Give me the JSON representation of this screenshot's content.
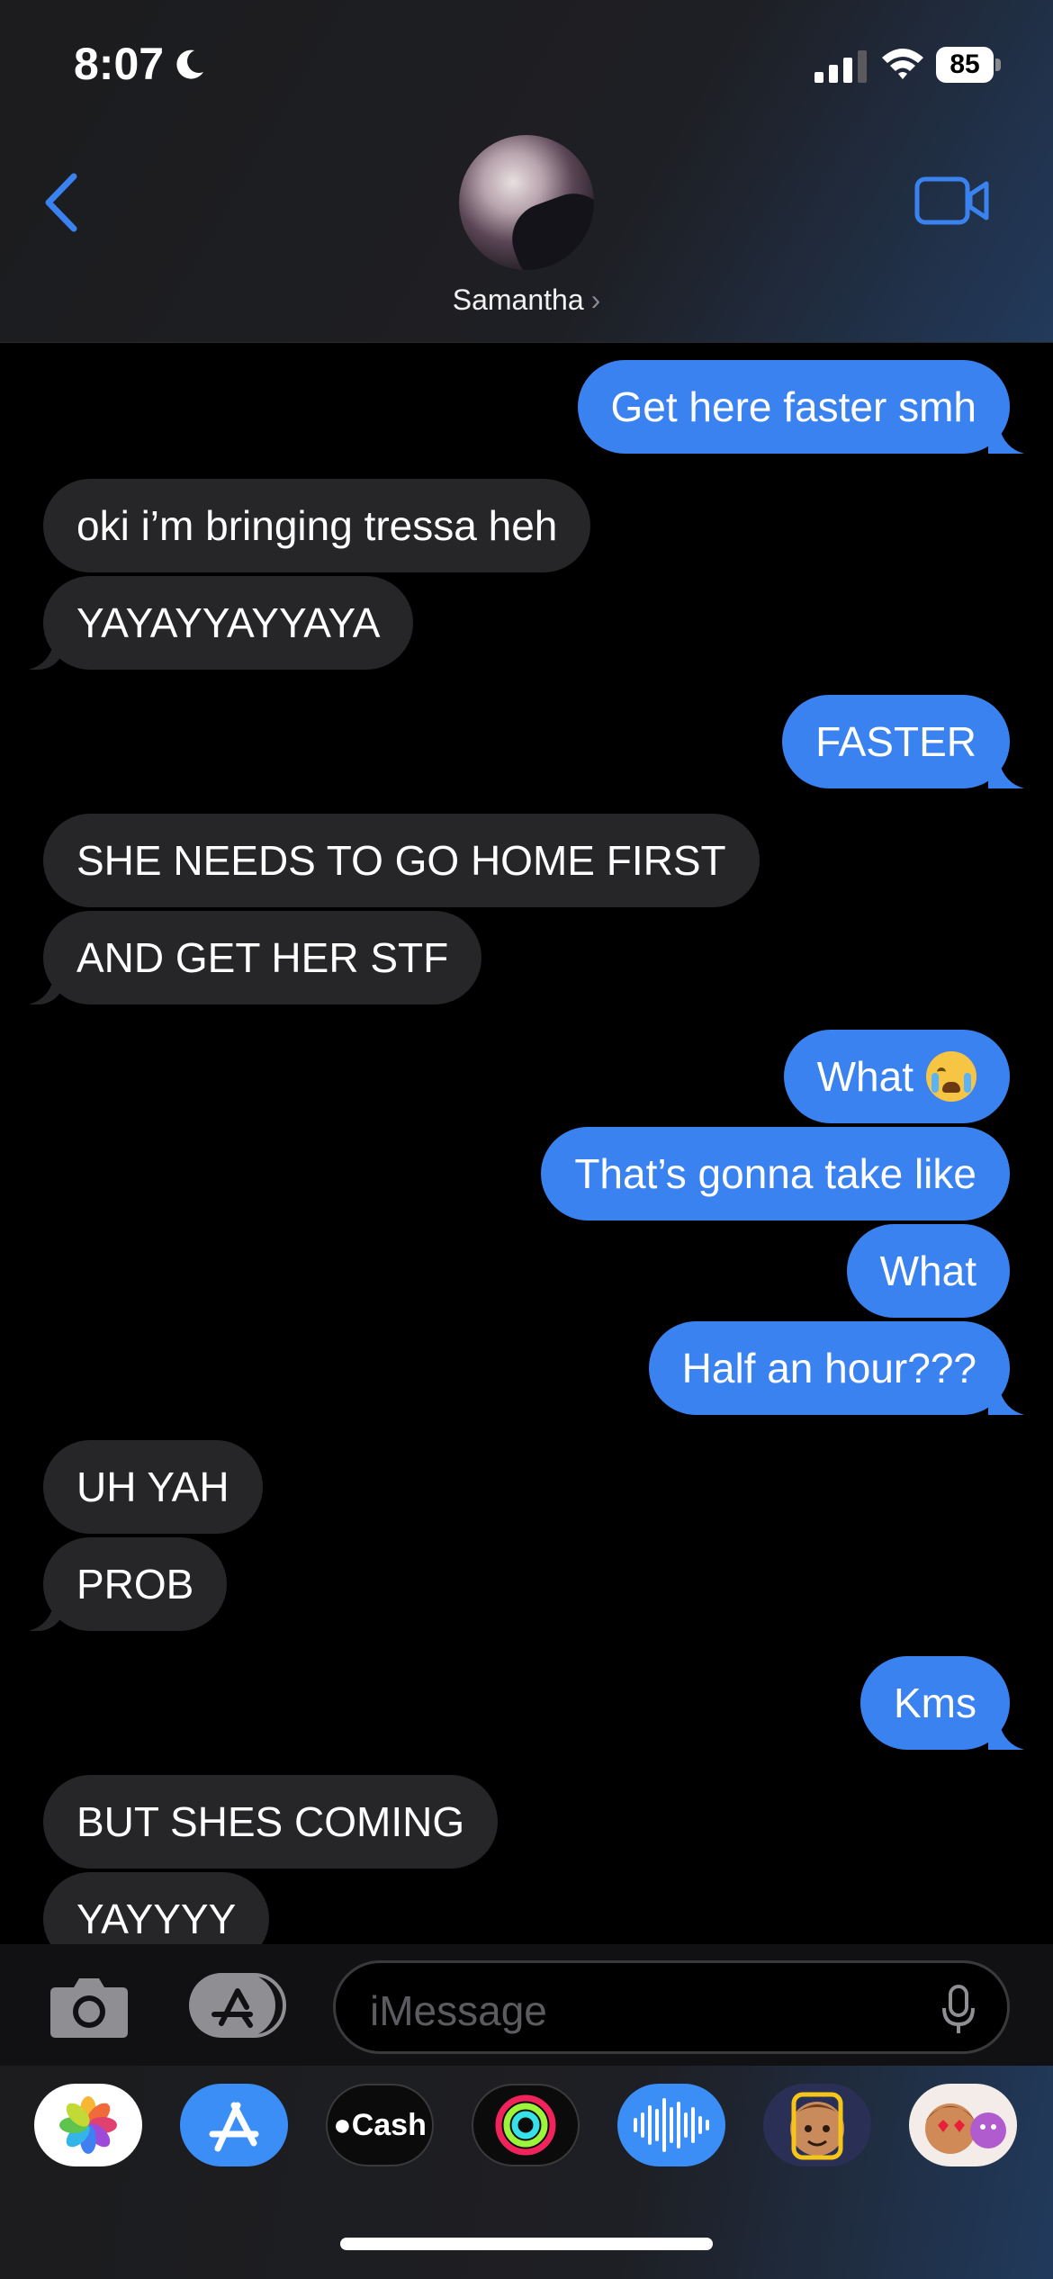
{
  "status_bar": {
    "time": "8:07",
    "battery": "85"
  },
  "header": {
    "contact_name": "Samantha",
    "chevron": "›"
  },
  "messages": [
    {
      "text": "Get here faster smh",
      "dir": "out"
    },
    {
      "text": "oki i’m bringing tressa heh",
      "dir": "in"
    },
    {
      "text": "YAYAYYAYYAYA",
      "dir": "in"
    },
    {
      "text": "FASTER",
      "dir": "out"
    },
    {
      "text": "SHE NEEDS TO GO HOME FIRST",
      "dir": "in"
    },
    {
      "text": "AND GET HER STF",
      "dir": "in"
    },
    {
      "text": "What",
      "dir": "out",
      "emoji": "loudly-crying-face"
    },
    {
      "text": "That’s gonna take like",
      "dir": "out"
    },
    {
      "text": "What",
      "dir": "out"
    },
    {
      "text": "Half an hour???",
      "dir": "out"
    },
    {
      "text": "UH YAH",
      "dir": "in"
    },
    {
      "text": "PROB",
      "dir": "in"
    },
    {
      "text": "Kms",
      "dir": "out"
    },
    {
      "text": "BUT SHES COMING",
      "dir": "in"
    },
    {
      "text": "YAYYYY",
      "dir": "in"
    }
  ],
  "compose": {
    "placeholder": "iMessage"
  },
  "app_drawer": {
    "apps": [
      "photos-icon",
      "app-store-icon",
      "apple-cash-icon",
      "fitness-icon",
      "audio-message-icon",
      "memoji-icon",
      "memoji-stickers-icon"
    ],
    "cash_label": "Cash"
  },
  "colors": {
    "outgoing": "#3b82f1",
    "incoming": "#262628",
    "accent": "#3b82f1"
  }
}
